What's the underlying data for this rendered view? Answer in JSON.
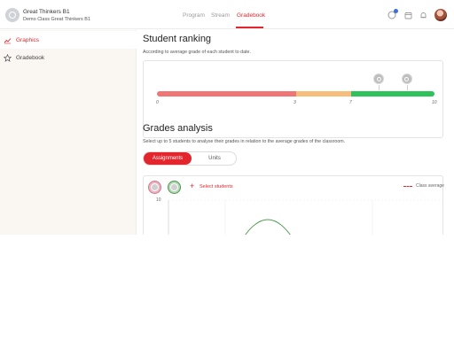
{
  "header": {
    "class_name": "Great Thinkers B1",
    "class_subtitle": "Demo Class Great Thinkers B1",
    "nav": [
      {
        "label": "Program",
        "active": false
      },
      {
        "label": "Stream",
        "active": false
      },
      {
        "label": "Gradebook",
        "active": true
      }
    ],
    "icons": [
      "notifications-badge-icon",
      "calendar-icon",
      "bell-icon",
      "user-avatar"
    ]
  },
  "sidebar": {
    "items": [
      {
        "label": "Graphics",
        "icon": "line-chart-icon",
        "active": true
      },
      {
        "label": "Gradebook",
        "icon": "star-icon",
        "active": false
      }
    ]
  },
  "ranking": {
    "title": "Student ranking",
    "description": "According to average grade of each student to date.",
    "scale_ticks": [
      "0",
      "3",
      "7",
      "10"
    ],
    "segments": [
      {
        "from": 0,
        "to": 5,
        "color": "#f07575"
      },
      {
        "from": 5,
        "to": 7,
        "color": "#f7bd7a"
      },
      {
        "from": 7,
        "to": 10,
        "color": "#2ec25a"
      }
    ],
    "students": [
      {
        "grade": 8.0,
        "icon": "student-avatar-icon"
      },
      {
        "grade": 9.0,
        "icon": "student-avatar-icon"
      }
    ]
  },
  "analysis": {
    "title": "Grades analysis",
    "description": "Select up to 5 students to analyse their grades in relation to the average grades of the classroom.",
    "tabs": [
      {
        "label": "Assignments",
        "active": true
      },
      {
        "label": "Units",
        "active": false
      }
    ],
    "select_label": "Select students",
    "legend_label": "Class average",
    "y_max_label": "10"
  },
  "colors": {
    "accent": "#e3262d",
    "low": "#f07575",
    "mid": "#f7bd7a",
    "high": "#2ec25a",
    "curve": "#4a9a4a"
  }
}
